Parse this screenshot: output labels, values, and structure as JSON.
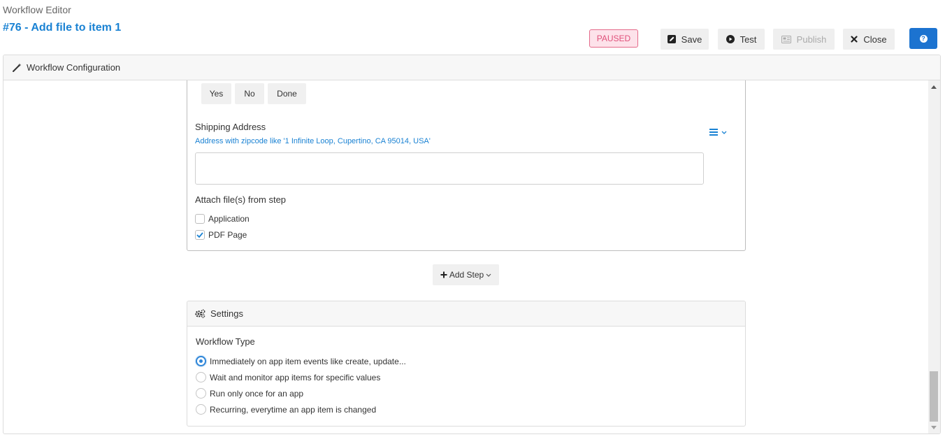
{
  "header": {
    "app_label": "Workflow Editor",
    "workflow_title": "#76 - Add file to item 1",
    "status": "PAUSED"
  },
  "toolbar": {
    "save_label": "Save",
    "test_label": "Test",
    "publish_label": "Publish",
    "close_label": "Close",
    "help_icon": "question-circle-icon"
  },
  "panel": {
    "title": "Workflow Configuration",
    "icon": "magic-wand-icon"
  },
  "step": {
    "option_buttons": [
      "Yes",
      "No",
      "Done"
    ],
    "shipping_label": "Shipping Address",
    "shipping_hint": "Address with zipcode like '1 Infinite Loop, Cupertino, CA 95014, USA'",
    "shipping_value": "",
    "attach_label": "Attach file(s) from step",
    "attachments": [
      {
        "label": "Application",
        "checked": false
      },
      {
        "label": "PDF Page",
        "checked": true
      }
    ]
  },
  "add_step": {
    "label": "Add Step"
  },
  "settings": {
    "title": "Settings",
    "workflow_type_label": "Workflow Type",
    "options": [
      {
        "label": "Immediately on app item events like create, update...",
        "checked": true
      },
      {
        "label": "Wait and monitor app items for specific values",
        "checked": false
      },
      {
        "label": "Run only once for an app",
        "checked": false
      },
      {
        "label": "Recurring, everytime an app item is changed",
        "checked": false
      }
    ]
  },
  "colors": {
    "accent": "#1a82d3",
    "primary_button": "#1c73d0",
    "paused_text": "#e0507a",
    "paused_bg": "#fde2ea"
  }
}
